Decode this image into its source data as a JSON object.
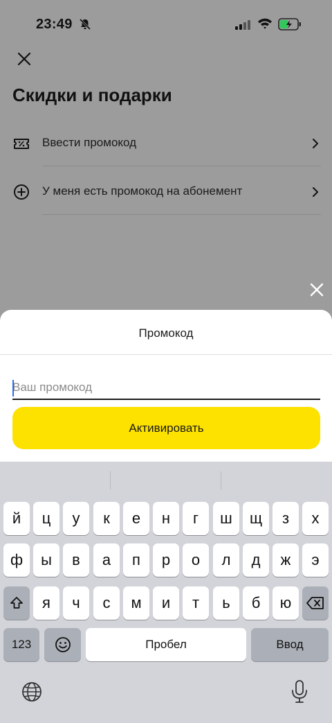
{
  "status_bar": {
    "time": "23:49"
  },
  "page": {
    "title": "Скидки и подарки",
    "items": [
      {
        "label": "Ввести промокод",
        "icon": "coupon-icon"
      },
      {
        "label": "У меня есть промокод на абонемент",
        "icon": "plus-circle-icon"
      }
    ]
  },
  "sheet": {
    "title": "Промокод",
    "input_placeholder": "Ваш промокод",
    "input_value": "",
    "activate_label": "Активировать"
  },
  "keyboard": {
    "row1": [
      "й",
      "ц",
      "у",
      "к",
      "е",
      "н",
      "г",
      "ш",
      "щ",
      "з",
      "х"
    ],
    "row2": [
      "ф",
      "ы",
      "в",
      "а",
      "п",
      "р",
      "о",
      "л",
      "д",
      "ж",
      "э"
    ],
    "row3": [
      "я",
      "ч",
      "с",
      "м",
      "и",
      "т",
      "ь",
      "б",
      "ю"
    ],
    "numbers_key": "123",
    "space_label": "Пробел",
    "enter_label": "Ввод"
  },
  "colors": {
    "accent_yellow": "#fde200",
    "caret_blue": "#2b6de9",
    "keyboard_bg": "#d2d4da"
  }
}
